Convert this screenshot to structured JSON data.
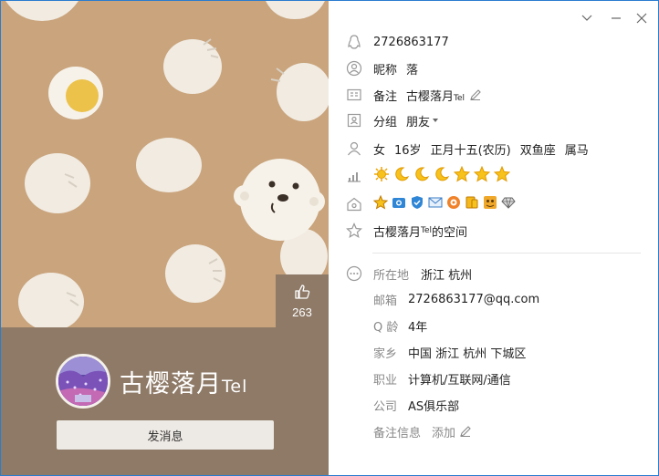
{
  "window": {
    "controls": [
      "chevron-down",
      "minimize",
      "close"
    ]
  },
  "profile": {
    "qq_number": "2726863177",
    "nickname_label": "昵称",
    "nickname": "落",
    "remark_label": "备注",
    "remark": "古樱落月",
    "remark_suffix": "Tel",
    "group_label": "分组",
    "group": "朋友",
    "gender": "女",
    "age": "16岁",
    "birthday": "正月十五(农历)",
    "zodiac": "双鱼座",
    "chinese_zodiac": "属马",
    "space_link": "古樱落月",
    "space_link_suffix": "Tel",
    "space_link_end": "的空间"
  },
  "level_icons": [
    "sun",
    "moon",
    "moon",
    "moon",
    "star",
    "star",
    "star"
  ],
  "service_icons": [
    "vip-crown",
    "camera",
    "shield",
    "mail",
    "music",
    "wallet",
    "game-pet",
    "diamond"
  ],
  "details": [
    {
      "label": "所在地",
      "value": "浙江 杭州"
    },
    {
      "label": "邮箱",
      "value": "2726863177@qq.com"
    },
    {
      "label": "Q 龄",
      "value": "4年"
    },
    {
      "label": "家乡",
      "value": "中国 浙江 杭州 下城区"
    },
    {
      "label": "职业",
      "value": "计算机/互联网/通信"
    },
    {
      "label": "公司",
      "value": "AS俱乐部"
    },
    {
      "label": "备注信息",
      "value": "添加"
    }
  ],
  "left": {
    "display_name": "古樱落月",
    "display_name_suffix": "Tel",
    "likes": "263",
    "send_button": "发消息"
  },
  "colors": {
    "cover_bg": "#c9a47c",
    "band": "#8e7a67",
    "accent_blue": "#2a7ccf",
    "star": "#f5b400"
  }
}
